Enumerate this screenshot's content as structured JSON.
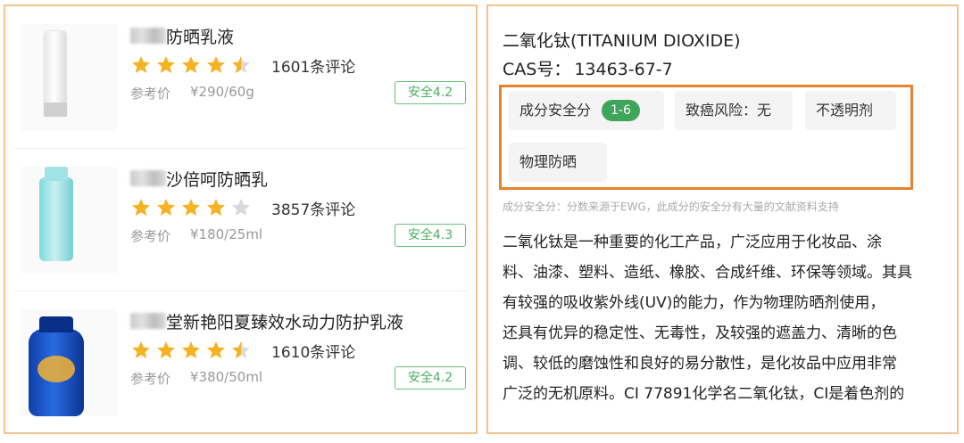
{
  "products": [
    {
      "name": "防晒乳液",
      "reviews": "1601条评论",
      "rating": 4.5,
      "price_label": "参考价",
      "price": "¥290/60g",
      "safety": "安全4.2",
      "image": "white-tube-icon"
    },
    {
      "name": "沙倍呵防晒乳",
      "reviews": "3857条评论",
      "rating": 4.0,
      "price_label": "参考价",
      "price": "¥180/25ml",
      "safety": "安全4.3",
      "image": "blue-bottle-icon"
    },
    {
      "name": "堂新艳阳夏臻效水动力防护乳液",
      "reviews": "1610条评论",
      "rating": 4.5,
      "price_label": "参考价",
      "price": "¥380/50ml",
      "safety": "安全4.2",
      "image": "navy-bottle-icon"
    }
  ],
  "ingredient": {
    "title": "二氧化钛(TITANIUM DIOXIDE)",
    "cas_label": "CAS号：",
    "cas_value": "13463-67-7",
    "tags": {
      "safety_label": "成分安全分",
      "safety_score": "1-6",
      "cancer_risk": "致癌风险：无",
      "function_1": "不透明剂",
      "function_2": "物理防晒"
    },
    "footnote": "成分安全分：分数来源于EWG，此成分的安全分有大量的文献资料支持",
    "description_lines": [
      "二氧化钛是一种重要的化工产品，广泛应用于化妆品、涂",
      "料、油漆、塑料、造纸、橡胶、合成纤维、环保等领域。其具",
      "有较强的吸收紫外线(UV)的能力，作为物理防晒剂使用，",
      "还具有优异的稳定性、无毒性，及较强的遮盖力、清晰的色",
      "调、较低的磨蚀性和良好的易分散性，是化妆品中应用非常",
      "广泛的无机原料。CI 77891化学名二氧化钛，CI是着色剂的"
    ]
  },
  "colors": {
    "star": "#f5b324",
    "star_empty": "#d9d9d9",
    "badge_green": "#4caf60",
    "highlight_orange": "#e8832d",
    "panel_border": "#f2c28f"
  }
}
